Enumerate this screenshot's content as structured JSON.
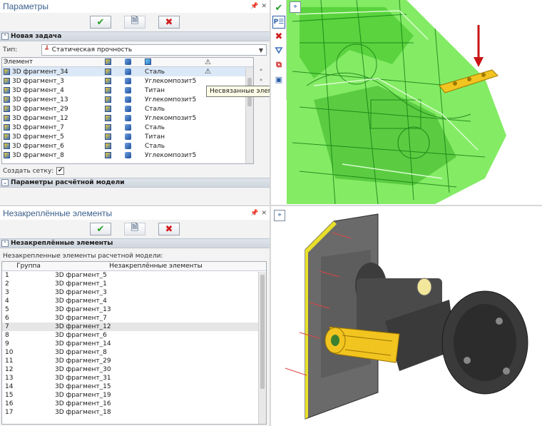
{
  "top_panel": {
    "title": "Параметры",
    "window_icons": [
      "pin-icon",
      "close-icon"
    ],
    "section_task": "Новая задача",
    "type_label": "Тип:",
    "type_value": "Статическая прочность",
    "columns": [
      "Элемент",
      "",
      "",
      "",
      ""
    ],
    "rows": [
      {
        "name": "3D фрагмент_34",
        "material": "Сталь",
        "warn": true
      },
      {
        "name": "3D фрагмент_3",
        "material": "Углекомпозит5",
        "warn": false
      },
      {
        "name": "3D фрагмент_4",
        "material": "Титан",
        "warn": false
      },
      {
        "name": "3D фрагмент_13",
        "material": "Углекомпозит5",
        "warn": false
      },
      {
        "name": "3D фрагмент_29",
        "material": "Сталь",
        "warn": false
      },
      {
        "name": "3D фрагмент_12",
        "material": "Углекомпозит5",
        "warn": false
      },
      {
        "name": "3D фрагмент_7",
        "material": "Сталь",
        "warn": false
      },
      {
        "name": "3D фрагмент_5",
        "material": "Титан",
        "warn": false
      },
      {
        "name": "3D фрагмент_6",
        "material": "Сталь",
        "warn": false
      },
      {
        "name": "3D фрагмент_8",
        "material": "Углекомпозит5",
        "warn": false
      }
    ],
    "tooltip": "Несвязанные элементы",
    "mesh_label": "Создать сетку:",
    "mesh_checked": "✔",
    "section_model": "Параметры расчётной модели"
  },
  "bottom_panel": {
    "title": "Незакреплённые элементы",
    "section": "Незакреплённые элементы",
    "caption": "Незакрепленные элементы расчетной модели:",
    "col_group": "Группа",
    "col_elems": "Незакреплённые элементы",
    "rows": [
      {
        "group": "1",
        "name": "3D фрагмент_5"
      },
      {
        "group": "2",
        "name": "3D фрагмент_1"
      },
      {
        "group": "3",
        "name": "3D фрагмент_3"
      },
      {
        "group": "4",
        "name": "3D фрагмент_4"
      },
      {
        "group": "5",
        "name": "3D фрагмент_13"
      },
      {
        "group": "6",
        "name": "3D фрагмент_7"
      },
      {
        "group": "7",
        "name": "3D фрагмент_12"
      },
      {
        "group": "8",
        "name": "3D фрагмент_6"
      },
      {
        "group": "9",
        "name": "3D фрагмент_14"
      },
      {
        "group": "10",
        "name": "3D фрагмент_8"
      },
      {
        "group": "11",
        "name": "3D фрагмент_29"
      },
      {
        "group": "12",
        "name": "3D фрагмент_30"
      },
      {
        "group": "13",
        "name": "3D фрагмент_31"
      },
      {
        "group": "14",
        "name": "3D фрагмент_15"
      },
      {
        "group": "15",
        "name": "3D фрагмент_19"
      },
      {
        "group": "16",
        "name": "3D фрагмент_16"
      },
      {
        "group": "17",
        "name": "3D фрагмент_18"
      }
    ]
  },
  "buttons": {
    "ok": "✔",
    "cancel": "✖"
  },
  "colors": {
    "accent": "#3a5f8c",
    "wire_green": "#46e02a",
    "part_yellow": "#f2c420",
    "arrow_red": "#c81414"
  }
}
